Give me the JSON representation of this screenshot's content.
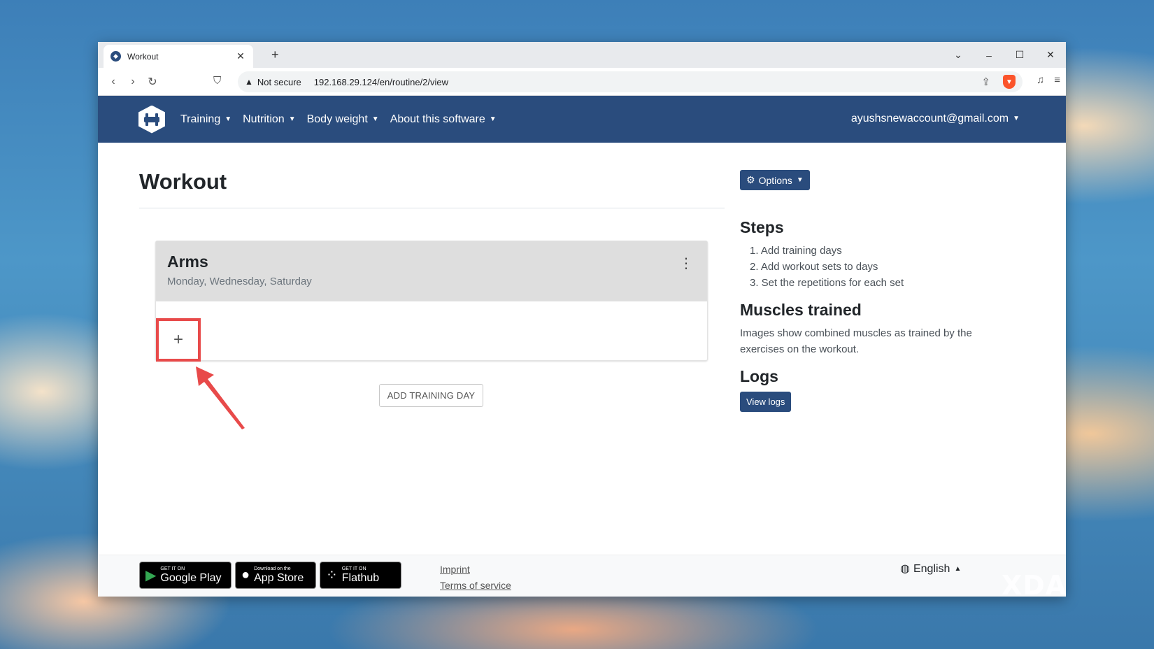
{
  "browser": {
    "tab_title": "Workout",
    "tab_close": "✕",
    "new_tab": "+",
    "security_label": "Not secure",
    "url": "192.168.29.124/en/routine/2/view"
  },
  "nav": {
    "items": [
      {
        "label": "Training"
      },
      {
        "label": "Nutrition"
      },
      {
        "label": "Body weight"
      },
      {
        "label": "About this software"
      }
    ],
    "user": "ayushsnewaccount@gmail.com"
  },
  "page": {
    "title": "Workout",
    "add_training_day": "ADD TRAINING DAY"
  },
  "training_day": {
    "name": "Arms",
    "days": "Monday, Wednesday, Saturday",
    "add_set": "+"
  },
  "sidebar": {
    "options_label": "Options",
    "steps_heading": "Steps",
    "steps": [
      "1. Add training days",
      "2. Add workout sets to days",
      "3. Set the repetitions for each set"
    ],
    "muscles_heading": "Muscles trained",
    "muscles_text": "Images show combined muscles as trained by the exercises on the workout.",
    "logs_heading": "Logs",
    "view_logs": "View logs"
  },
  "footer": {
    "google_play_small": "GET IT ON",
    "google_play_big": "Google Play",
    "app_store_small": "Download on the",
    "app_store_big": "App Store",
    "flathub_small": "GET IT ON",
    "flathub_big": "Flathub",
    "imprint": "Imprint",
    "terms": "Terms of service",
    "language": "English"
  },
  "watermark": "XDA",
  "colors": {
    "navbar": "#2a4c7d",
    "highlight": "#e84a4a"
  }
}
